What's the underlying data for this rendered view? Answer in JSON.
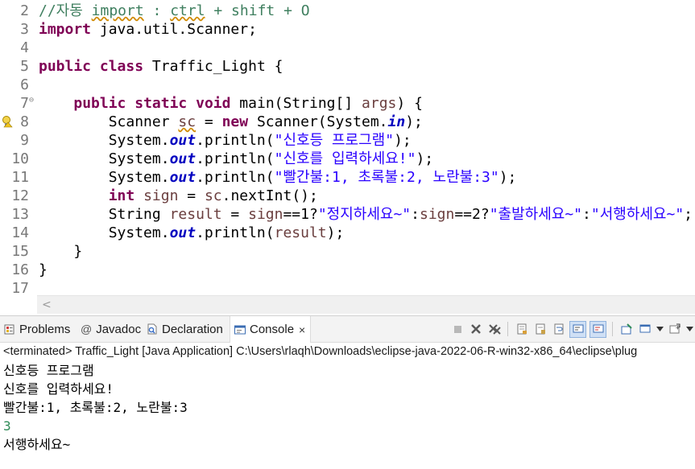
{
  "editor": {
    "lines": [
      {
        "num": "2",
        "parts": [
          {
            "t": "//자동 ",
            "c": "cm"
          },
          {
            "t": "import",
            "c": "cm squig"
          },
          {
            "t": " : ",
            "c": "cm"
          },
          {
            "t": "ctrl",
            "c": "cm squig"
          },
          {
            "t": " + shift + O",
            "c": "cm"
          }
        ]
      },
      {
        "num": "3",
        "parts": [
          {
            "t": "import",
            "c": "kw"
          },
          {
            "t": " java.util.Scanner;",
            "c": ""
          }
        ]
      },
      {
        "num": "4",
        "parts": []
      },
      {
        "num": "5",
        "parts": [
          {
            "t": "public",
            "c": "kw"
          },
          {
            "t": " ",
            "c": ""
          },
          {
            "t": "class",
            "c": "kw"
          },
          {
            "t": " Traffic_Light {",
            "c": ""
          }
        ]
      },
      {
        "num": "6",
        "parts": []
      },
      {
        "num": "7",
        "fold": true,
        "parts": [
          {
            "t": "    ",
            "c": ""
          },
          {
            "t": "public",
            "c": "kw"
          },
          {
            "t": " ",
            "c": ""
          },
          {
            "t": "static",
            "c": "kw"
          },
          {
            "t": " ",
            "c": ""
          },
          {
            "t": "void",
            "c": "kw"
          },
          {
            "t": " main(String[] ",
            "c": ""
          },
          {
            "t": "args",
            "c": "vr"
          },
          {
            "t": ") {",
            "c": ""
          }
        ]
      },
      {
        "num": "8",
        "warning": true,
        "parts": [
          {
            "t": "        Scanner ",
            "c": ""
          },
          {
            "t": "sc",
            "c": "vr squig"
          },
          {
            "t": " = ",
            "c": ""
          },
          {
            "t": "new",
            "c": "kw"
          },
          {
            "t": " Scanner(System.",
            "c": ""
          },
          {
            "t": "in",
            "c": "fi"
          },
          {
            "t": ");",
            "c": ""
          }
        ]
      },
      {
        "num": "9",
        "parts": [
          {
            "t": "        System.",
            "c": ""
          },
          {
            "t": "out",
            "c": "fi"
          },
          {
            "t": ".println(",
            "c": ""
          },
          {
            "t": "\"신호등 프로그램\"",
            "c": "st"
          },
          {
            "t": ");",
            "c": ""
          }
        ]
      },
      {
        "num": "10",
        "parts": [
          {
            "t": "        System.",
            "c": ""
          },
          {
            "t": "out",
            "c": "fi"
          },
          {
            "t": ".println(",
            "c": ""
          },
          {
            "t": "\"신호를 입력하세요!\"",
            "c": "st"
          },
          {
            "t": ");",
            "c": ""
          }
        ]
      },
      {
        "num": "11",
        "parts": [
          {
            "t": "        System.",
            "c": ""
          },
          {
            "t": "out",
            "c": "fi"
          },
          {
            "t": ".println(",
            "c": ""
          },
          {
            "t": "\"빨간불:1, 초록불:2, 노란불:3\"",
            "c": "st"
          },
          {
            "t": ");",
            "c": ""
          }
        ]
      },
      {
        "num": "12",
        "parts": [
          {
            "t": "        ",
            "c": ""
          },
          {
            "t": "int",
            "c": "kw"
          },
          {
            "t": " ",
            "c": ""
          },
          {
            "t": "sign",
            "c": "vr"
          },
          {
            "t": " = ",
            "c": ""
          },
          {
            "t": "sc",
            "c": "vr"
          },
          {
            "t": ".nextInt();",
            "c": ""
          }
        ]
      },
      {
        "num": "13",
        "parts": [
          {
            "t": "        String ",
            "c": ""
          },
          {
            "t": "result",
            "c": "vr"
          },
          {
            "t": " = ",
            "c": ""
          },
          {
            "t": "sign",
            "c": "vr"
          },
          {
            "t": "==1?",
            "c": ""
          },
          {
            "t": "\"정지하세요~\"",
            "c": "st"
          },
          {
            "t": ":",
            "c": ""
          },
          {
            "t": "sign",
            "c": "vr"
          },
          {
            "t": "==2?",
            "c": ""
          },
          {
            "t": "\"출발하세요~\"",
            "c": "st"
          },
          {
            "t": ":",
            "c": ""
          },
          {
            "t": "\"서행하세요~\"",
            "c": "st"
          },
          {
            "t": ";",
            "c": ""
          }
        ]
      },
      {
        "num": "14",
        "parts": [
          {
            "t": "        System.",
            "c": ""
          },
          {
            "t": "out",
            "c": "fi"
          },
          {
            "t": ".println(",
            "c": ""
          },
          {
            "t": "result",
            "c": "vr"
          },
          {
            "t": ");",
            "c": ""
          }
        ]
      },
      {
        "num": "15",
        "parts": [
          {
            "t": "    }",
            "c": ""
          }
        ]
      },
      {
        "num": "16",
        "parts": [
          {
            "t": "}",
            "c": ""
          }
        ]
      },
      {
        "num": "17",
        "parts": []
      }
    ],
    "scroll_left_glyph": "<"
  },
  "console": {
    "tabs": {
      "problems": "Problems",
      "javadoc_at": "@",
      "javadoc": "Javadoc",
      "declaration": "Declaration",
      "console": "Console",
      "close": "×"
    },
    "status": "<terminated> Traffic_Light [Java Application] C:\\Users\\rlaqh\\Downloads\\eclipse-java-2022-06-R-win32-x86_64\\eclipse\\plug",
    "output": [
      {
        "text": "신호등 프로그램",
        "kind": "out"
      },
      {
        "text": "신호를 입력하세요!",
        "kind": "out"
      },
      {
        "text": "빨간불:1, 초록불:2, 노란불:3",
        "kind": "out"
      },
      {
        "text": "3",
        "kind": "input"
      },
      {
        "text": "서행하세요~",
        "kind": "out"
      }
    ]
  },
  "colors": {
    "keyword": "#7f0055",
    "comment": "#3f7f5f",
    "string": "#2a00ff",
    "field": "#0000c0",
    "variable": "#6a3e3e",
    "stdin": "#2e8b57"
  }
}
